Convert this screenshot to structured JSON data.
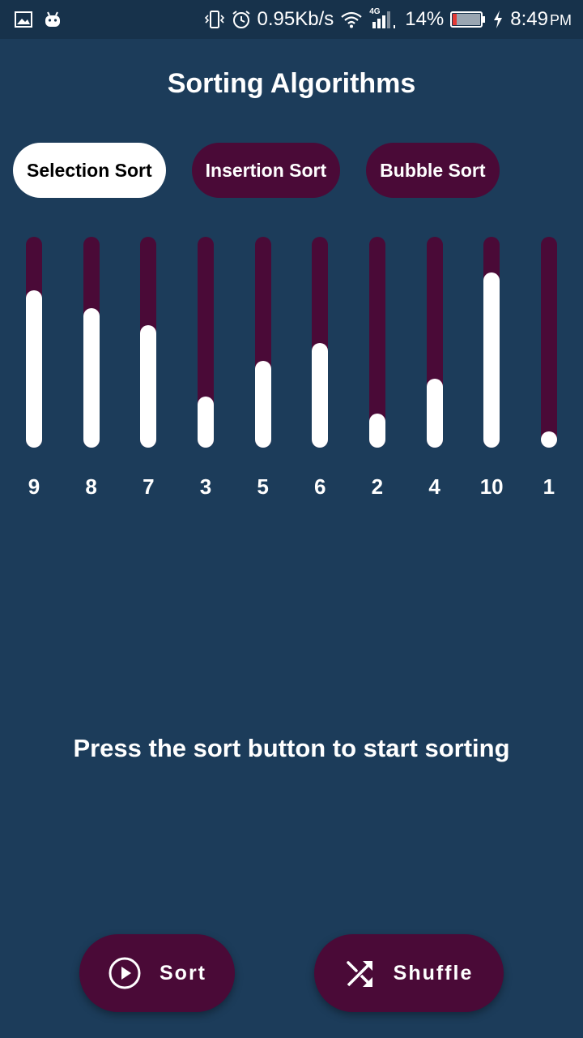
{
  "status_bar": {
    "network_speed": "0.95Kb/s",
    "network_type": "4G",
    "battery": "14%",
    "time": "8:49",
    "time_suffix": "PM",
    "icons": [
      "image-icon",
      "android-icon",
      "vibrate-icon",
      "alarm-icon",
      "wifi-icon",
      "signal-icon",
      "battery-icon",
      "charging-icon"
    ]
  },
  "app": {
    "title": "Sorting Algorithms"
  },
  "algorithms": [
    {
      "label": "Selection Sort",
      "selected": true
    },
    {
      "label": "Insertion Sort",
      "selected": false
    },
    {
      "label": "Bubble Sort",
      "selected": false
    }
  ],
  "bars": {
    "values": [
      "9",
      "8",
      "7",
      "3",
      "5",
      "6",
      "2",
      "4",
      "10",
      "1"
    ],
    "max": 10
  },
  "hint": "Press the sort button to start sorting",
  "actions": {
    "sort_label": "Sort",
    "shuffle_label": "Shuffle"
  },
  "colors": {
    "background": "#1c3c5a",
    "status_bar": "#17324b",
    "accent": "#4a0a37",
    "bar_fill": "#ffffff"
  }
}
